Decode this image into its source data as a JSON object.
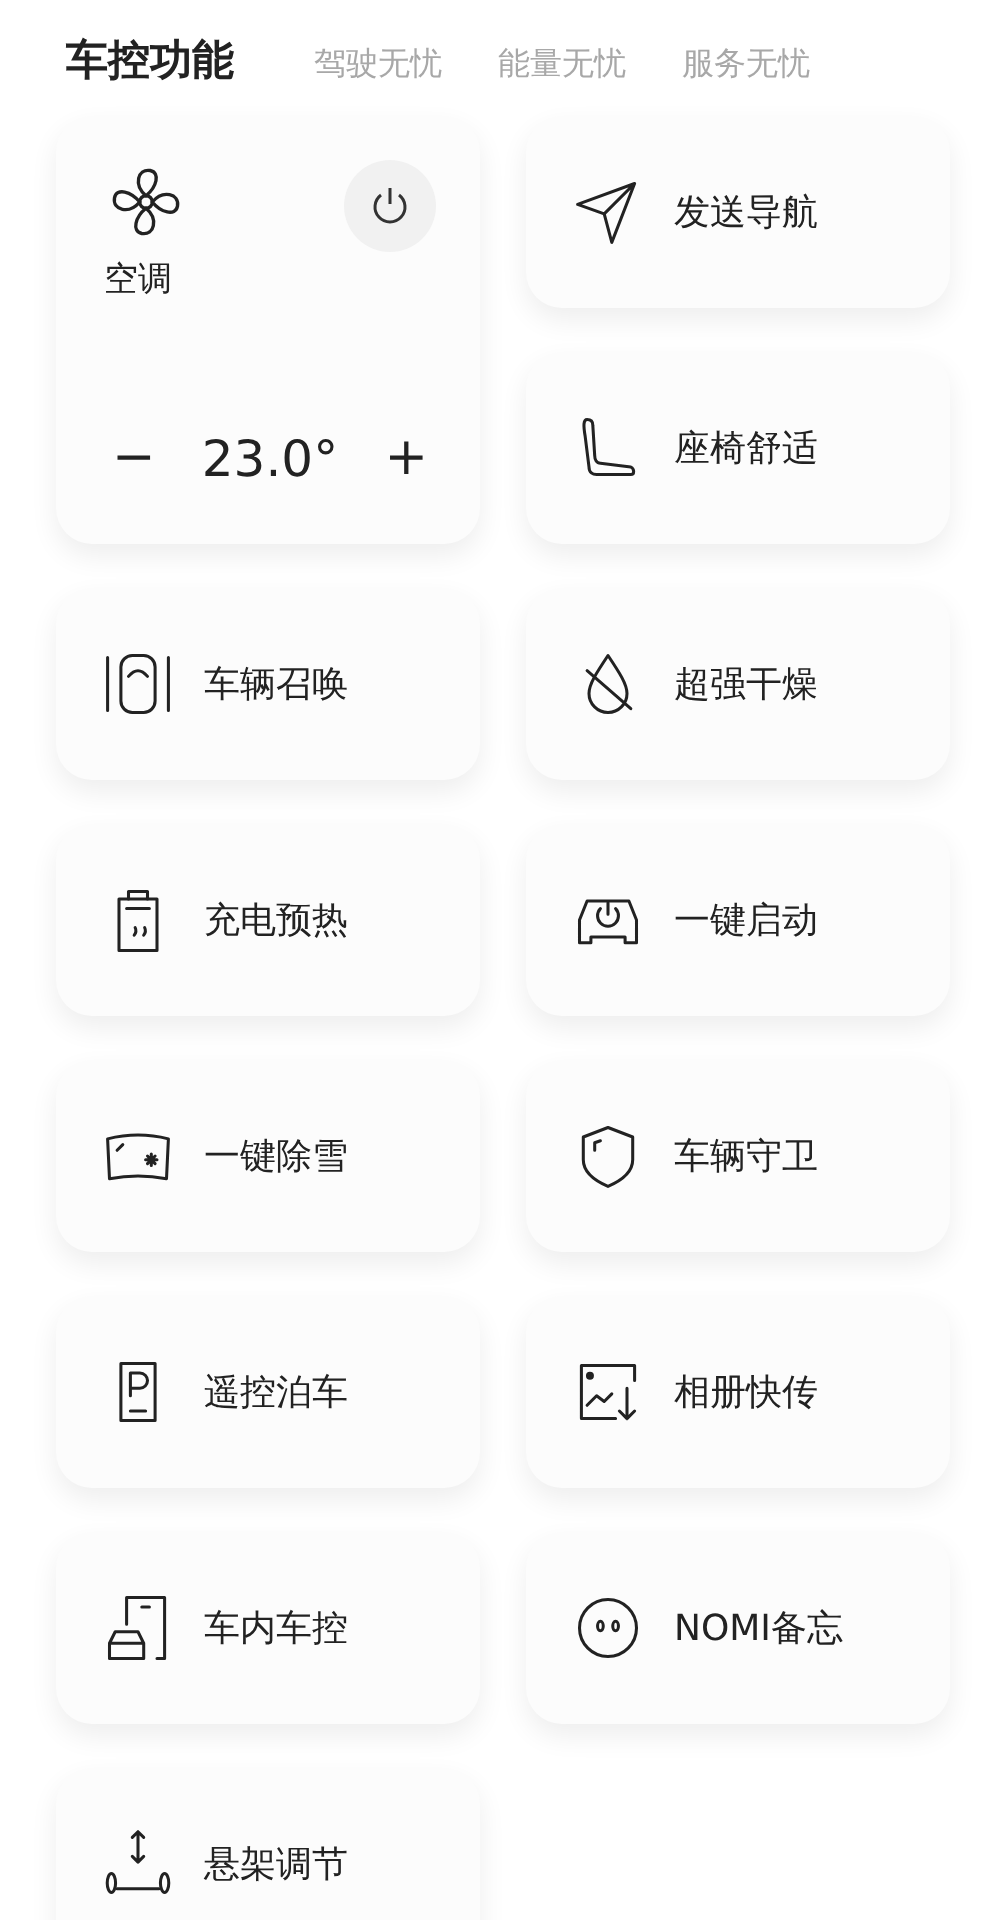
{
  "tabs": [
    {
      "label": "车控功能",
      "selected": true
    },
    {
      "label": "驾驶无忧",
      "selected": false
    },
    {
      "label": "能量无忧",
      "selected": false
    },
    {
      "label": "服务无忧",
      "selected": false
    }
  ],
  "climate": {
    "label": "空调",
    "minus": "−",
    "temperature": "23.0°",
    "plus": "+"
  },
  "tiles": [
    {
      "label": "发送导航"
    },
    {
      "label": "座椅舒适"
    },
    {
      "label": "车辆召唤"
    },
    {
      "label": "超强干燥"
    },
    {
      "label": "充电预热"
    },
    {
      "label": "一键启动"
    },
    {
      "label": "一键除雪"
    },
    {
      "label": "车辆守卫"
    },
    {
      "label": "遥控泊车"
    },
    {
      "label": "相册快传"
    },
    {
      "label": "车内车控"
    },
    {
      "label": "NOMI备忘"
    },
    {
      "label": "悬架调节"
    }
  ]
}
